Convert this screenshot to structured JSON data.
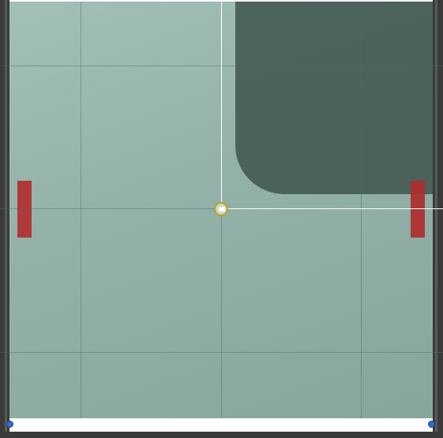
{
  "scene": {
    "type": "game-editor-viewport",
    "background_colors": {
      "play_area": "#93b1a8",
      "frame": "#3a3a3a",
      "shadow_panel": "#3c504b",
      "paddle": "#b03a3a",
      "ball_ring": "#b5a51c",
      "selection_handle": "#2f6ed8",
      "crosshair": "#ffffff"
    },
    "icons": {
      "ball": "ball-icon",
      "handle": "resize-handle-icon"
    }
  }
}
